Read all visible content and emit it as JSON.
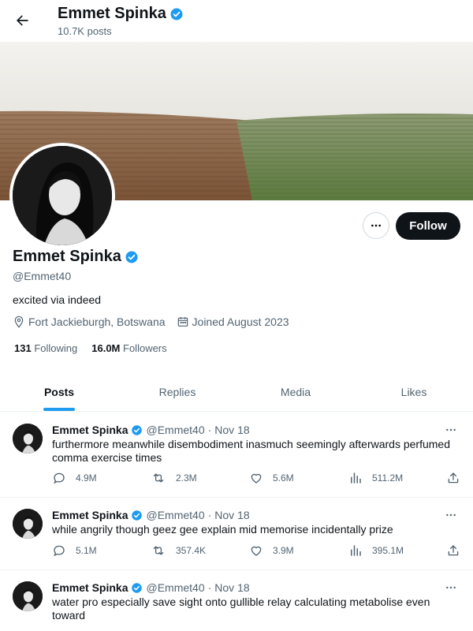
{
  "header": {
    "title": "Emmet Spinka",
    "post_count": "10.7K posts"
  },
  "profile": {
    "name": "Emmet Spinka",
    "handle": "@Emmet40",
    "bio": "excited via indeed",
    "location": "Fort Jackieburgh, Botswana",
    "joined": "Joined August 2023",
    "following_count": "131",
    "following_label": "Following",
    "followers_count": "16.0M",
    "followers_label": "Followers",
    "follow_label": "Follow"
  },
  "tabs": [
    {
      "label": "Posts",
      "active": true
    },
    {
      "label": "Replies",
      "active": false
    },
    {
      "label": "Media",
      "active": false
    },
    {
      "label": "Likes",
      "active": false
    }
  ],
  "tweets": [
    {
      "name": "Emmet Spinka",
      "handle": "@Emmet40",
      "dot": "·",
      "date": "Nov 18",
      "text": "furthermore meanwhile disembodiment inasmuch seemingly afterwards perfumed comma exercise times",
      "replies": "4.9M",
      "retweets": "2.3M",
      "likes": "5.6M",
      "views": "511.2M"
    },
    {
      "name": "Emmet Spinka",
      "handle": "@Emmet40",
      "dot": "·",
      "date": "Nov 18",
      "text": "while angrily though geez gee explain mid memorise incidentally prize",
      "replies": "5.1M",
      "retweets": "357.4K",
      "likes": "3.9M",
      "views": "395.1M"
    },
    {
      "name": "Emmet Spinka",
      "handle": "@Emmet40",
      "dot": "·",
      "date": "Nov 18",
      "text": "water pro especially save sight onto gullible relay calculating metabolise even toward",
      "replies": "",
      "retweets": "",
      "likes": "",
      "views": ""
    }
  ],
  "colors": {
    "accent": "#1d9bf0",
    "text": "#0f1419",
    "muted": "#536471",
    "border": "#eff3f4"
  },
  "icons": [
    "back-arrow-icon",
    "verified-badge-icon",
    "location-pin-icon",
    "calendar-icon",
    "more-icon",
    "reply-icon",
    "retweet-icon",
    "like-icon",
    "views-icon",
    "share-icon"
  ]
}
